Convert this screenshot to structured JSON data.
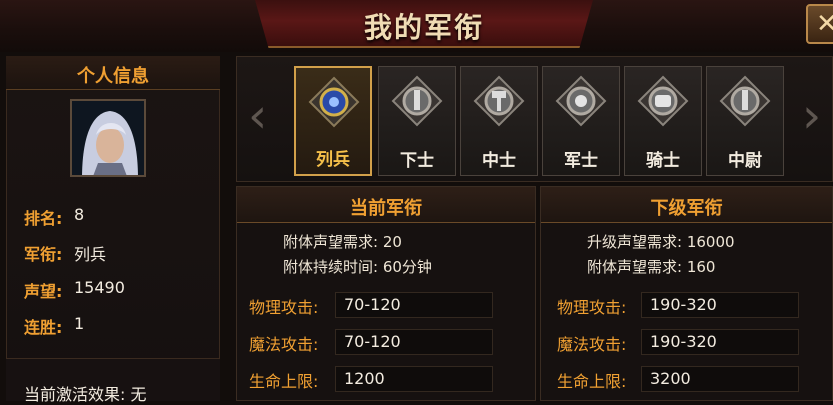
{
  "window": {
    "title": "我的军衔",
    "close_glyph": "✕"
  },
  "profile": {
    "header": "个人信息",
    "rows": [
      {
        "label": "排名:",
        "value": "8"
      },
      {
        "label": "军衔:",
        "value": "列兵"
      },
      {
        "label": "声望:",
        "value": "15490"
      },
      {
        "label": "连胜:",
        "value": "1"
      }
    ],
    "effect": "当前激活效果: 无"
  },
  "ranks": {
    "prev_glyph": "‹",
    "next_glyph": "›",
    "items": [
      {
        "label": "列兵",
        "icon": "gem-icon",
        "active": true
      },
      {
        "label": "下士",
        "icon": "sword-icon",
        "active": false
      },
      {
        "label": "中士",
        "icon": "hammer-icon",
        "active": false
      },
      {
        "label": "军士",
        "icon": "orb-icon",
        "active": false
      },
      {
        "label": "骑士",
        "icon": "fist-icon",
        "active": false
      },
      {
        "label": "中尉",
        "icon": "sword-icon",
        "active": false
      }
    ]
  },
  "current_rank": {
    "title": "当前军衔",
    "req1": "附体声望需求: 20",
    "req2": "附体持续时间: 60分钟",
    "stats": [
      {
        "label": "物理攻击:",
        "value": "70-120"
      },
      {
        "label": "魔法攻击:",
        "value": "70-120"
      },
      {
        "label": "生命上限:",
        "value": "1200"
      }
    ]
  },
  "next_rank": {
    "title": "下级军衔",
    "req1": "升级声望需求: 16000",
    "req2": "附体声望需求: 160",
    "stats": [
      {
        "label": "物理攻击:",
        "value": "190-320"
      },
      {
        "label": "魔法攻击:",
        "value": "190-320"
      },
      {
        "label": "生命上限:",
        "value": "3200"
      }
    ]
  }
}
